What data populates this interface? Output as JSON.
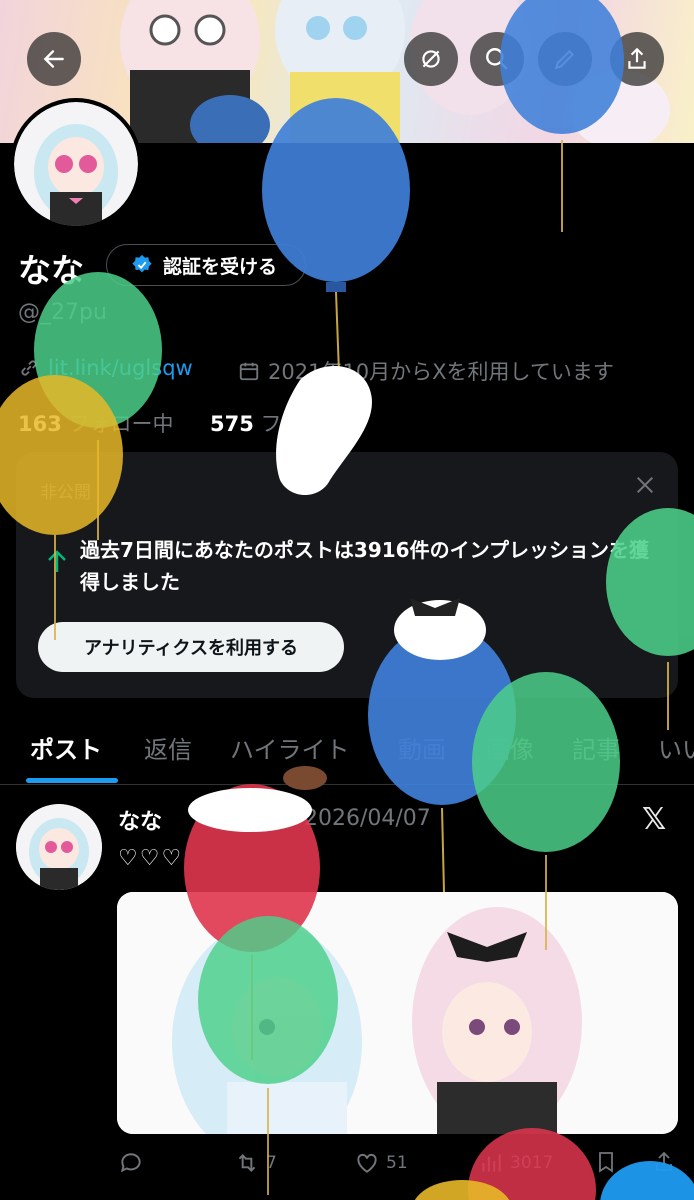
{
  "profile": {
    "name": "なな",
    "verify_label": "認証を受ける",
    "handle": "@_27pu",
    "link": "lit.link/uglsqw",
    "joined": "2021年10月からXを利用しています",
    "following_count": "163",
    "following_label": "フォロー中",
    "followers_count": "575",
    "followers_label": "フォロワー"
  },
  "analytics_card": {
    "tag": "非公開",
    "message": "過去7日間にあなたのポストは3916件のインプレッションを獲得しました",
    "cta_label": "アナリティクスを利用する"
  },
  "tabs": [
    {
      "label": "ポスト"
    },
    {
      "label": "返信"
    },
    {
      "label": "ハイライト"
    },
    {
      "label": "動画"
    },
    {
      "label": "画像"
    },
    {
      "label": "記事"
    },
    {
      "label": "いい"
    }
  ],
  "post": {
    "author": "なな",
    "date": "2026/04/07",
    "text": "♡♡♡",
    "retweets": "7",
    "likes": "51",
    "views": "3017"
  },
  "colors": {
    "accent": "#1d9bf0",
    "balloon_blue": "#3f7fd9",
    "balloon_green": "#4ccf8a",
    "balloon_yellow": "#e8b828",
    "balloon_red": "#e0364f"
  }
}
